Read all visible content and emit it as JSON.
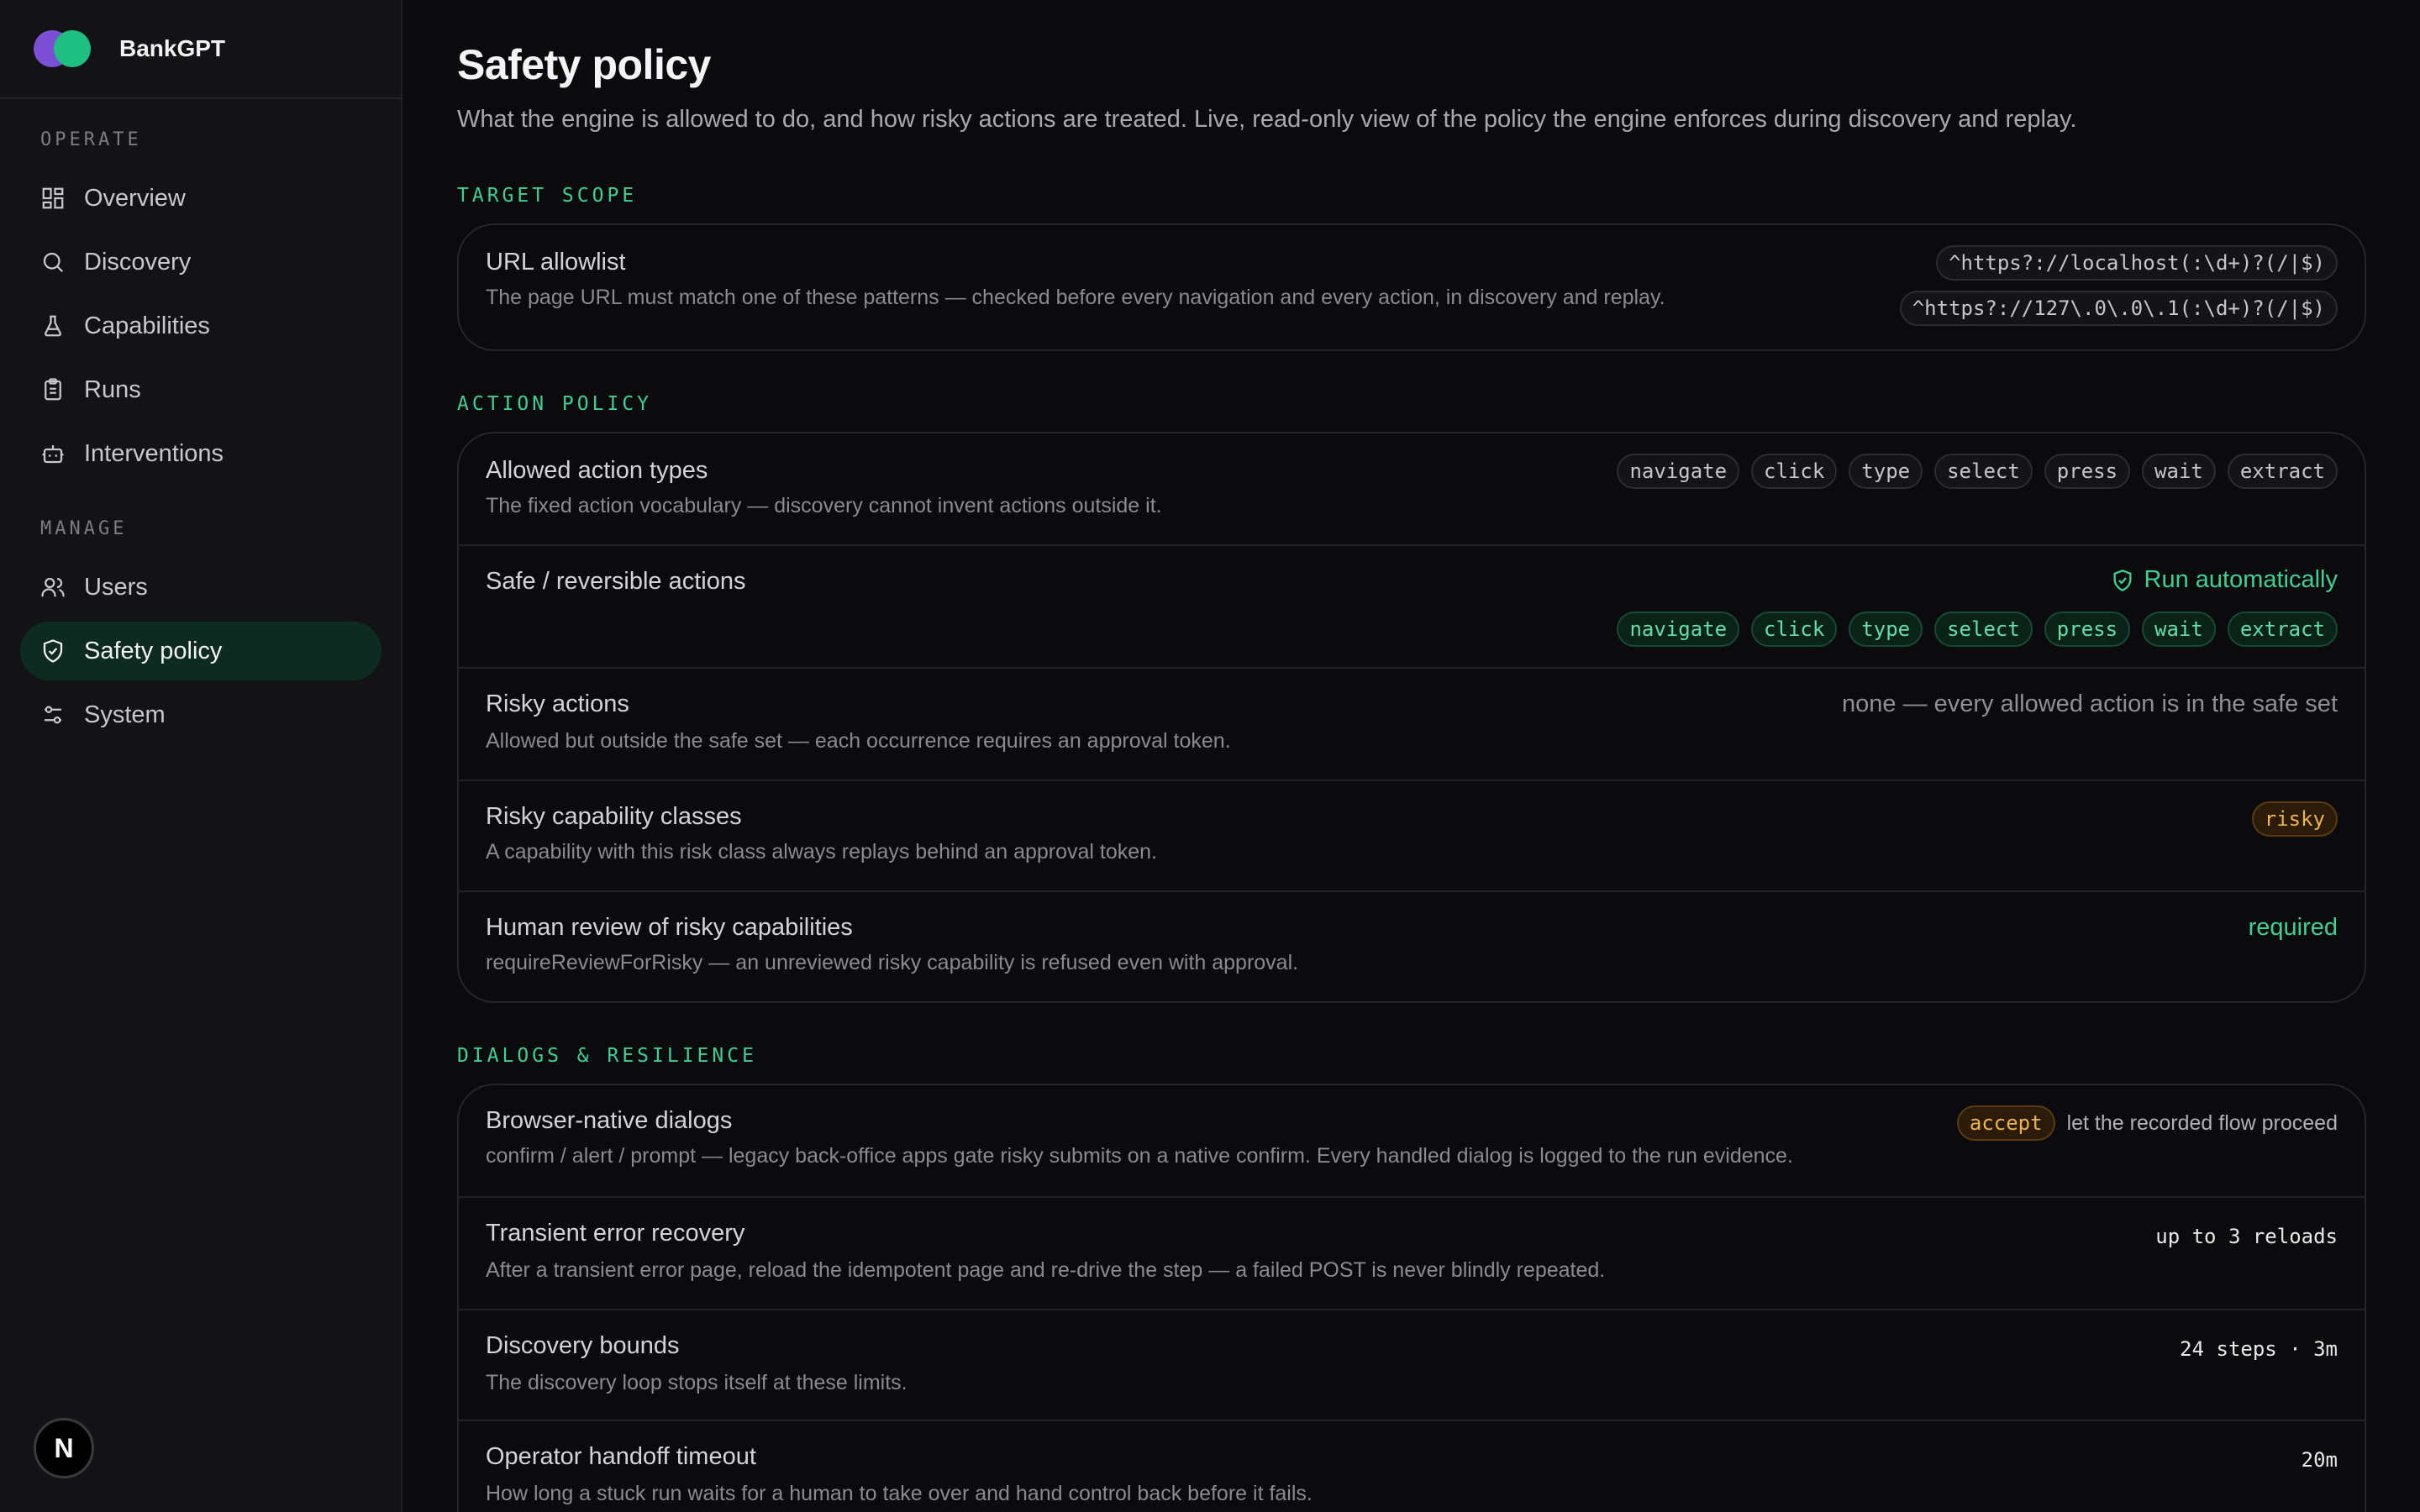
{
  "app": {
    "name": "BankGPT"
  },
  "sidebar": {
    "operate_label": "OPERATE",
    "manage_label": "MANAGE",
    "operate_items": [
      {
        "label": "Overview",
        "icon": "dashboard-icon"
      },
      {
        "label": "Discovery",
        "icon": "search-icon"
      },
      {
        "label": "Capabilities",
        "icon": "flask-icon"
      },
      {
        "label": "Runs",
        "icon": "clipboard-icon"
      },
      {
        "label": "Interventions",
        "icon": "bot-icon"
      }
    ],
    "manage_items": [
      {
        "label": "Users",
        "icon": "users-icon"
      },
      {
        "label": "Safety policy",
        "icon": "shield-check-icon",
        "active": true
      },
      {
        "label": "System",
        "icon": "sliders-icon"
      }
    ],
    "avatar_initial": "N"
  },
  "page": {
    "title": "Safety policy",
    "subtitle": "What the engine is allowed to do, and how risky actions are treated. Live, read-only view of the policy the engine enforces during discovery and replay."
  },
  "target_scope": {
    "heading": "TARGET SCOPE",
    "url_allowlist": {
      "title": "URL allowlist",
      "desc": "The page URL must match one of these patterns — checked before every navigation and every action, in discovery and replay.",
      "patterns": [
        "^https?://localhost(:\\d+)?(/|$)",
        "^https?://127\\.0\\.0\\.1(:\\d+)?(/|$)"
      ]
    }
  },
  "action_policy": {
    "heading": "ACTION POLICY",
    "allowed_types": {
      "title": "Allowed action types",
      "desc": "The fixed action vocabulary — discovery cannot invent actions outside it.",
      "chips": [
        "navigate",
        "click",
        "type",
        "select",
        "press",
        "wait",
        "extract"
      ]
    },
    "safe_actions": {
      "title": "Safe / reversible actions",
      "status": "Run automatically",
      "chips": [
        "navigate",
        "click",
        "type",
        "select",
        "press",
        "wait",
        "extract"
      ]
    },
    "risky_actions": {
      "title": "Risky actions",
      "desc": "Allowed but outside the safe set — each occurrence requires an approval token.",
      "value": "none — every allowed action is in the safe set"
    },
    "risky_classes": {
      "title": "Risky capability classes",
      "desc": "A capability with this risk class always replays behind an approval token.",
      "chip": "risky"
    },
    "human_review": {
      "title": "Human review of risky capabilities",
      "desc": "requireReviewForRisky — an unreviewed risky capability is refused even with approval.",
      "value": "required"
    }
  },
  "dialogs": {
    "heading": "DIALOGS & RESILIENCE",
    "browser_dialogs": {
      "title": "Browser-native dialogs",
      "desc": "confirm / alert / prompt — legacy back-office apps gate risky submits on a native confirm. Every handled dialog is logged to the run evidence.",
      "chip": "accept",
      "note": "let the recorded flow proceed"
    },
    "error_recovery": {
      "title": "Transient error recovery",
      "desc": "After a transient error page, reload the idempotent page and re-drive the step — a failed POST is never blindly repeated.",
      "value": "up to 3 reloads"
    },
    "discovery_bounds": {
      "title": "Discovery bounds",
      "desc": "The discovery loop stops itself at these limits.",
      "value": "24 steps · 3m"
    },
    "handoff_timeout": {
      "title": "Operator handoff timeout",
      "desc": "How long a stuck run waits for a human to take over and hand control back before it fails.",
      "value": "20m"
    }
  },
  "colors": {
    "accent": "#3fcf95",
    "warning": "#f0b24a",
    "background": "#0b0b0d",
    "sidebar": "#131315"
  }
}
